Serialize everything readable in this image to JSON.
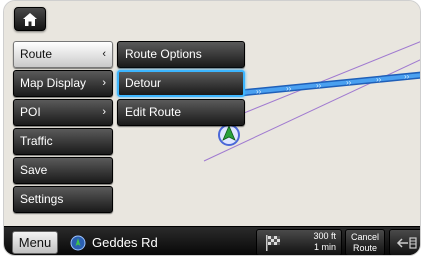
{
  "map": {
    "colors": {
      "background": "#e9e6df",
      "route": "#2f7fe0",
      "route_arrow": "#9fd0ff",
      "road": "#a07ad0",
      "position_marker": "#2aa13a",
      "position_ring": "#4a67d8"
    }
  },
  "home_button": {
    "icon": "home-icon"
  },
  "menu": {
    "items": [
      {
        "label": "Route",
        "arrow": "‹"
      },
      {
        "label": "Map Display",
        "arrow": "›"
      },
      {
        "label": "POI",
        "arrow": "›"
      },
      {
        "label": "Traffic",
        "arrow": ""
      },
      {
        "label": "Save",
        "arrow": ""
      },
      {
        "label": "Settings",
        "arrow": ""
      }
    ]
  },
  "submenu": {
    "items": [
      {
        "label": "Route Options"
      },
      {
        "label": "Detour"
      },
      {
        "label": "Edit Route"
      }
    ],
    "selected": "Detour",
    "highlight_color": "#3db6ff"
  },
  "bottom_bar": {
    "menu_label": "Menu",
    "road_icon": "compass-icon",
    "road_name": "Geddes Rd",
    "next_turn_icon": "destination-flag-icon",
    "distance": "300 ft",
    "time": "1 min",
    "cancel_label_line1": "Cancel",
    "cancel_label_line2": "Route",
    "back_icon": "back-arrow-icon"
  }
}
